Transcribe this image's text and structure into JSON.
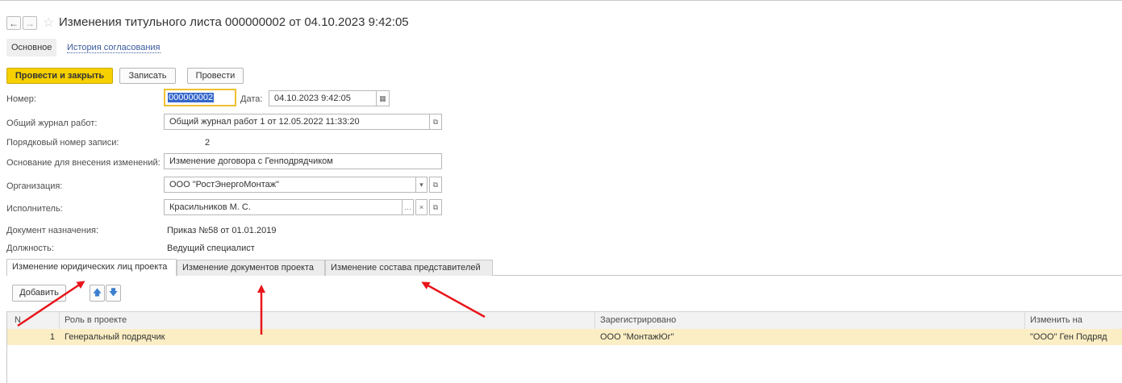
{
  "window": {
    "title": "Изменения титульного листа 000000002 от 04.10.2023 9:42:05",
    "back_icon": "arrow-left-icon",
    "forward_icon": "arrow-right-icon",
    "favorite_icon": "star-icon"
  },
  "subnav": {
    "main": "Основное",
    "history": "История согласования"
  },
  "toolbar": {
    "post_close": "Провести и закрыть",
    "save": "Записать",
    "post": "Провести"
  },
  "form": {
    "number_label": "Номер:",
    "number_value": "000000002",
    "date_label": "Дата:",
    "date_value": "04.10.2023  9:42:05",
    "journal_label": "Общий журнал работ:",
    "journal_value": "Общий журнал работ 1 от 12.05.2022 11:33:20",
    "record_no_label": "Порядковый номер записи:",
    "record_no_value": "2",
    "basis_label": "Основание для внесения изменений:",
    "basis_value": "Изменение договора с Генподрядчиком",
    "org_label": "Организация:",
    "org_value": "ООО \"РостЭнергоМонтаж\"",
    "executor_label": "Исполнитель:",
    "executor_value": "Красильников М. С.",
    "doc_label": "Документ назначения:",
    "doc_value": "Приказ №58 от 01.01.2019",
    "position_label": "Должность:",
    "position_value": "Ведущий специалист"
  },
  "tabs": [
    {
      "label": "Изменение юридических лиц проекта",
      "active": true
    },
    {
      "label": "Изменение документов проекта",
      "active": false
    },
    {
      "label": "Изменение состава представителей",
      "active": false
    }
  ],
  "table_toolbar": {
    "add": "Добавить"
  },
  "table": {
    "columns": [
      "N",
      "Роль в проекте",
      "Зарегистрировано",
      "Изменить на"
    ],
    "rows": [
      {
        "n": "1",
        "role": "Генеральный подрядчик",
        "registered": "ООО \"МонтажЮг\"",
        "change_to": "\"ООО\" Ген Подряд"
      }
    ]
  },
  "colors": {
    "accent": "#f6d000",
    "selected_row": "#fbeec4",
    "annotation_arrow": "#e8151b",
    "link": "#3a5a9c"
  }
}
